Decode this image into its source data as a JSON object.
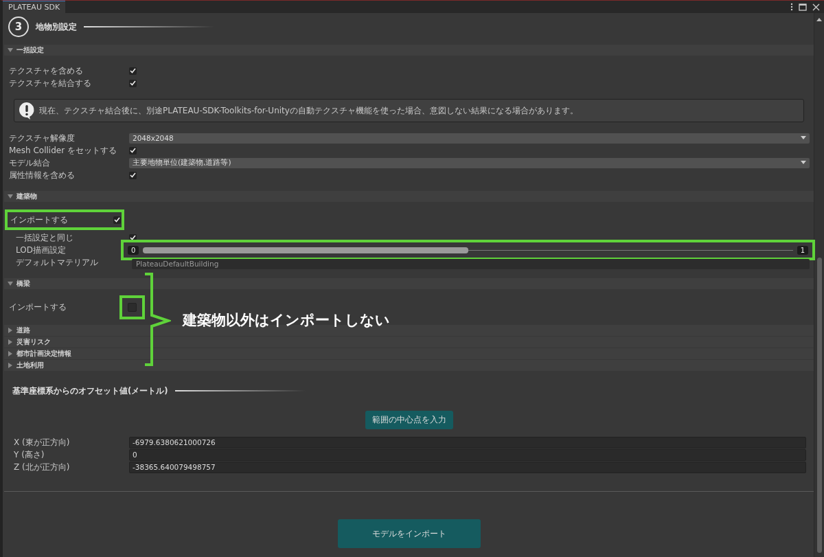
{
  "window": {
    "title": "PLATEAU SDK"
  },
  "step": {
    "number": "3",
    "title": "地物別設定"
  },
  "bulk_settings": {
    "title": "一括設定",
    "expanded": true,
    "rows": [
      {
        "kind": "checkbox",
        "label": "テクスチャを含める",
        "checked": true
      },
      {
        "kind": "checkbox",
        "label": "テクスチャを結合する",
        "checked": true
      },
      {
        "kind": "notice",
        "text": "現在、テクスチャ結合後に、別途PLATEAU-SDK-Toolkits-for-Unityの自動テクスチャ機能を使った場合、意図しない結果になる場合があります。"
      },
      {
        "kind": "dropdown",
        "label": "テクスチャ解像度",
        "value": "2048x2048"
      },
      {
        "kind": "checkbox",
        "label": "Mesh Collider をセットする",
        "checked": true
      },
      {
        "kind": "dropdown",
        "label": "モデル結合",
        "value": "主要地物単位(建築物,道路等)"
      },
      {
        "kind": "checkbox",
        "label": "属性情報を含める",
        "checked": true
      }
    ]
  },
  "packages": [
    {
      "title": "建築物",
      "expanded": true,
      "rows": [
        {
          "kind": "checkbox",
          "label": "インポートする",
          "checked": true,
          "row_highlighted": true
        },
        {
          "kind": "checkbox",
          "label": "一括設定と同じ",
          "checked": true,
          "indent": true
        },
        {
          "kind": "range",
          "label": "LOD描画設定",
          "min_label": "0",
          "max_label": "1",
          "level": 0.5,
          "indent": true,
          "control_highlighted": true
        },
        {
          "kind": "object",
          "label": "デフォルトマテリアル",
          "value": "PlateauDefaultBuilding",
          "indent": true
        }
      ]
    },
    {
      "title": "橋梁",
      "expanded": true,
      "rows": [
        {
          "kind": "checkbox",
          "label": "インポートする",
          "checked": false,
          "control_highlighted": true
        }
      ]
    },
    {
      "title": "道路",
      "expanded": false
    },
    {
      "title": "災害リスク",
      "expanded": false
    },
    {
      "title": "都市計画決定情報",
      "expanded": false
    },
    {
      "title": "土地利用",
      "expanded": false
    }
  ],
  "annotation": {
    "text": "建築物以外はインポートしない"
  },
  "offset": {
    "title": "基準座標系からのオフセット値(メートル)",
    "button": "範囲の中心点を入力",
    "fields": [
      {
        "label": "X (東が正方向)",
        "value": "-6979.6380621000726"
      },
      {
        "label": "Y (高さ)",
        "value": "0"
      },
      {
        "label": "Z (北が正方向)",
        "value": "-38365.640079498757"
      }
    ]
  },
  "import_button": "モデルをインポート"
}
